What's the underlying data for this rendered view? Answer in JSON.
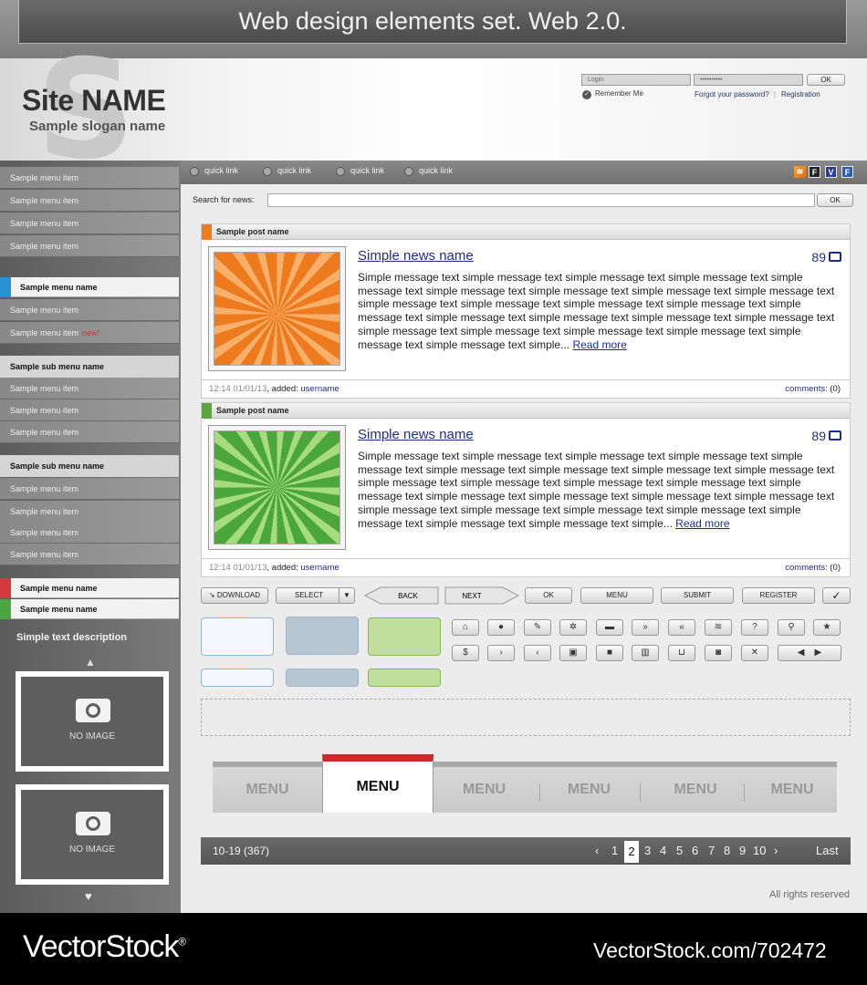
{
  "banner": {
    "title": "Web design elements set. Web 2.0."
  },
  "header": {
    "logo_letter": "S",
    "site_name": "Site NAME",
    "slogan": "Sample slogan name",
    "login_placeholder": "Login",
    "password_placeholder": "••••••••••",
    "login_ok": "OK",
    "remember_me": "Remember Me",
    "forgot_password": "Forgot your password?",
    "separator": "|",
    "registration": "Registration"
  },
  "quick_links": [
    "quick link",
    "quick link",
    "quick link",
    "quick link"
  ],
  "social_icons": [
    "rss-icon",
    "facebook-icon",
    "vimeo-icon",
    "friendfeed-icon"
  ],
  "social_labels": [
    "",
    "F",
    "V",
    "F"
  ],
  "sidebar": {
    "group1": [
      "Sample menu item",
      "Sample menu item",
      "Sample menu item",
      "Sample menu item"
    ],
    "active1": "Sample menu name",
    "group2": [
      "Sample menu item",
      "Sample menu item"
    ],
    "new_badge": "new!",
    "sub1": "Sample sub menu name",
    "group3": [
      "Sample menu item",
      "Sample menu item",
      "Sample menu item"
    ],
    "sub2": "Sample sub menu name",
    "group4": [
      "Sample menu item",
      "Sample menu item",
      "Sample menu item",
      "Sample menu item"
    ],
    "active2": "Sample menu name",
    "active3": "Sample menu name",
    "description": "Simple text description",
    "no_image": "NO IMAGE"
  },
  "search": {
    "label": "Search for news:",
    "button": "OK"
  },
  "posts": [
    {
      "header": "Sample post name",
      "accent": "#f07b1f",
      "title": "Simple news name",
      "count": "89",
      "text": "Simple message text simple  message text simple message text simple message text simple message text simple message text simple message text simple message text simple message text simple message text simple message text simple message text simple message text simple message text simple message text simple message text simple message text simple  message text simple message text simple message text simple message text simple message text simple message text simple message text simple...",
      "read_more": "Read more",
      "time": "12:14  01/01/13",
      "added": ", added: ",
      "user": "username",
      "comments_label": "comments: ",
      "comments": "(0)"
    },
    {
      "header": "Sample post name",
      "accent": "#5aa63a",
      "title": "Simple news name",
      "count": "89",
      "text": "Simple message text simple  message text simple message text simple message text simple message text simple message text simple message text simple message text simple message text simple message text simple message text simple message text simple message text simple message text simple message text simple message text simple message text simple message text simple  message text simple message text simple message text simple message text simple message text simple message text simple message text simple...",
      "read_more": "Read more",
      "time": "12:14  01/01/13",
      "added": ", added: ",
      "user": "username",
      "comments_label": "comments: ",
      "comments": "(0)"
    }
  ],
  "buttons": {
    "download": "DOWNLOAD",
    "select": "SELECT",
    "back": "BACK",
    "next": "NEXT",
    "ok": "OK",
    "menu": "MENU",
    "submit": "SUBMIT",
    "register": "REGISTER"
  },
  "icons_row1": [
    "home-icon",
    "user-icon",
    "pencil-icon",
    "gear-icon",
    "comment-icon",
    "double-down-icon",
    "double-up-icon",
    "rss-icon",
    "question-icon",
    "search-icon",
    "star-icon"
  ],
  "icons_row2": [
    "dollar-icon",
    "chevron-right-icon",
    "chevron-left-icon",
    "save-icon",
    "lock-icon",
    "chart-icon",
    "cart-icon",
    "camera-icon",
    "close-icon",
    "prev-next-icon"
  ],
  "tabs": {
    "items": [
      "MENU",
      "MENU",
      "MENU",
      "MENU",
      "MENU"
    ],
    "active": "MENU"
  },
  "pager": {
    "range": "10-19 (367)",
    "pages": [
      "1",
      "2",
      "3",
      "4",
      "5",
      "6",
      "7",
      "8",
      "9",
      "10"
    ],
    "current": "2",
    "last": "Last"
  },
  "footer": {
    "rights": "All rights reserved",
    "brand": "VectorStock",
    "brand_suffix": "®",
    "id": "VectorStock.com/702472"
  }
}
